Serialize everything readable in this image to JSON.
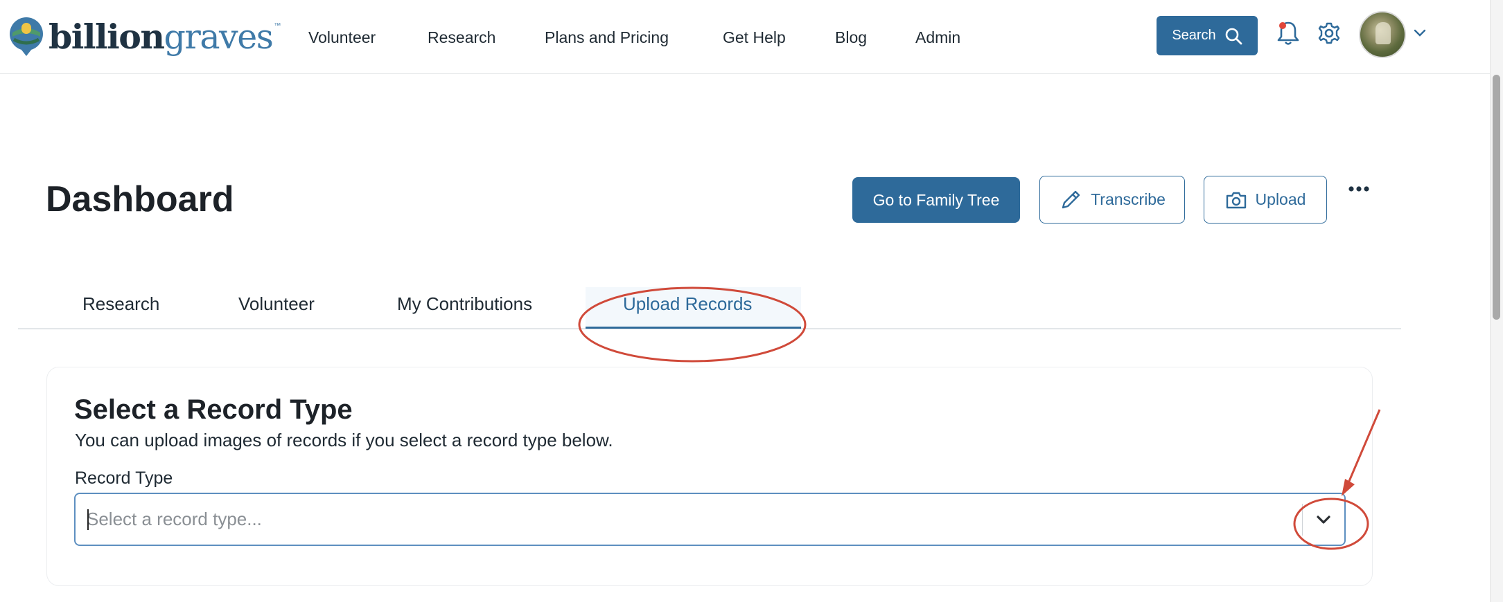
{
  "header": {
    "logo": {
      "part1": "billion",
      "part2": "graves",
      "tm": "™"
    },
    "nav": [
      {
        "label": "Volunteer"
      },
      {
        "label": "Research"
      },
      {
        "label": "Plans and Pricing"
      },
      {
        "label": "Get Help"
      },
      {
        "label": "Blog"
      },
      {
        "label": "Admin"
      }
    ],
    "search_label": "Search",
    "icons": [
      "logo-icon",
      "search-icon",
      "bell-icon",
      "gear-icon",
      "chevron-down-icon"
    ]
  },
  "page": {
    "title": "Dashboard",
    "actions": {
      "family_tree": "Go to Family Tree",
      "transcribe": "Transcribe",
      "upload": "Upload"
    }
  },
  "tabs": [
    {
      "label": "Research"
    },
    {
      "label": "Volunteer"
    },
    {
      "label": "My Contributions"
    },
    {
      "label": "Upload Records",
      "active": true
    }
  ],
  "card": {
    "title": "Select a Record Type",
    "subtitle": "You can upload images of records if you select a record type below.",
    "field_label": "Record Type",
    "select_placeholder": "Select a record type..."
  },
  "colors": {
    "brand_blue": "#2e6a9a",
    "logo_dark": "#1f3242",
    "logo_light": "#3f7aa8",
    "annotation_red": "#d04a3a"
  }
}
